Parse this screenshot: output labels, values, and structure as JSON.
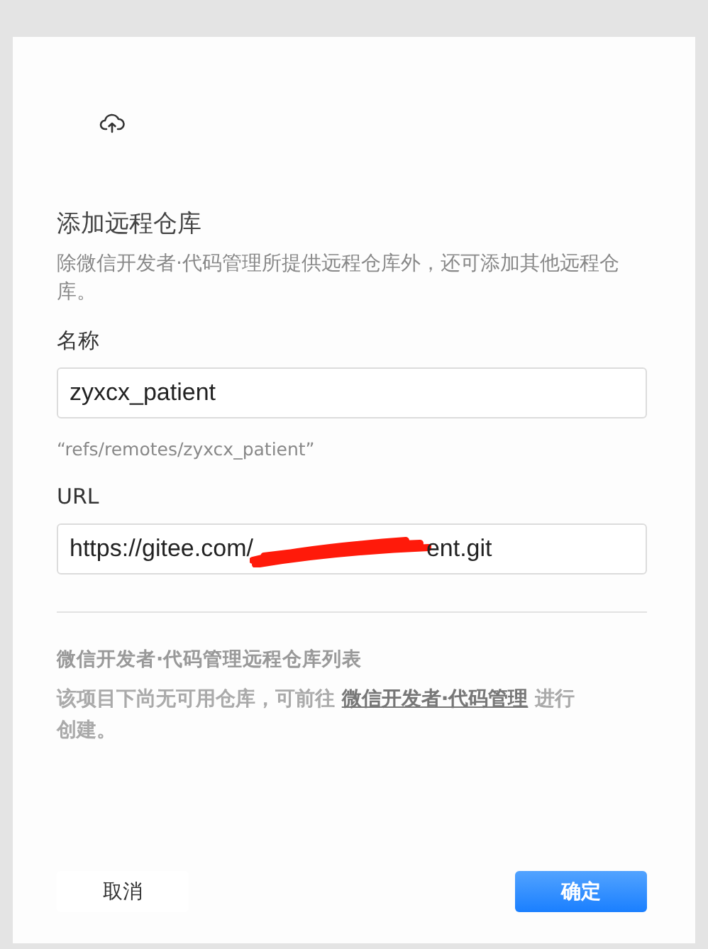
{
  "dialog": {
    "title": "添加远程仓库",
    "description": "除微信开发者·代码管理所提供远程仓库外，还可添加其他远程仓库。",
    "name_field": {
      "label": "名称",
      "value": "zyxcx_patient",
      "hint": "“refs/remotes/zyxcx_patient”"
    },
    "url_field": {
      "label": "URL",
      "value_start": "https://gitee.com/",
      "redacted": true,
      "value_end": "ent.git"
    },
    "repo_list": {
      "title": "微信开发者·代码管理远程仓库列表",
      "message_start": "该项目下尚无可用仓库，可前往",
      "link": "微信开发者·代码管理",
      "message_end": "进行创建。"
    },
    "buttons": [
      {
        "label": "取消",
        "kind": "secondary"
      },
      {
        "label": "确定",
        "kind": "primary"
      }
    ]
  }
}
